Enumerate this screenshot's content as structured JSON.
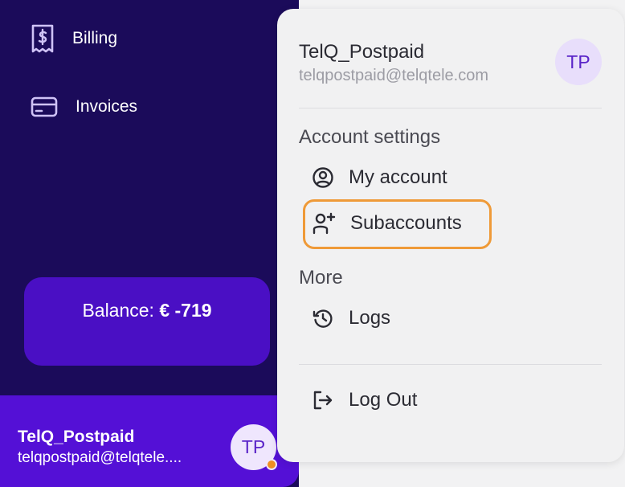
{
  "sidebar": {
    "nav": [
      {
        "label": "Billing",
        "icon": "receipt-dollar-icon"
      },
      {
        "label": "Invoices",
        "icon": "credit-card-icon"
      }
    ],
    "balance": {
      "prefix": "Balance:",
      "amount": "€ -719"
    },
    "user": {
      "name": "TelQ_Postpaid",
      "email": "telqpostpaid@telqtele....",
      "initials": "TP",
      "status_color": "#ef8f23"
    }
  },
  "dropdown": {
    "user": {
      "name": "TelQ_Postpaid",
      "email": "telqpostpaid@telqtele.com",
      "initials": "TP"
    },
    "sections": [
      {
        "title": "Account settings",
        "items": [
          {
            "label": "My account",
            "icon": "user-circle-icon"
          },
          {
            "label": "Subaccounts",
            "icon": "add-user-icon",
            "highlighted": true
          }
        ]
      },
      {
        "title": "More",
        "items": [
          {
            "label": "Logs",
            "icon": "history-icon"
          }
        ]
      }
    ],
    "logout": {
      "label": "Log Out",
      "icon": "logout-icon"
    }
  },
  "colors": {
    "sidebar_bg": "#1b0b5a",
    "balance_bg": "#4a0fc4",
    "footer_bg": "#5410d6",
    "accent_purple": "#5a24c8",
    "highlight_orange": "#ef9a38"
  }
}
